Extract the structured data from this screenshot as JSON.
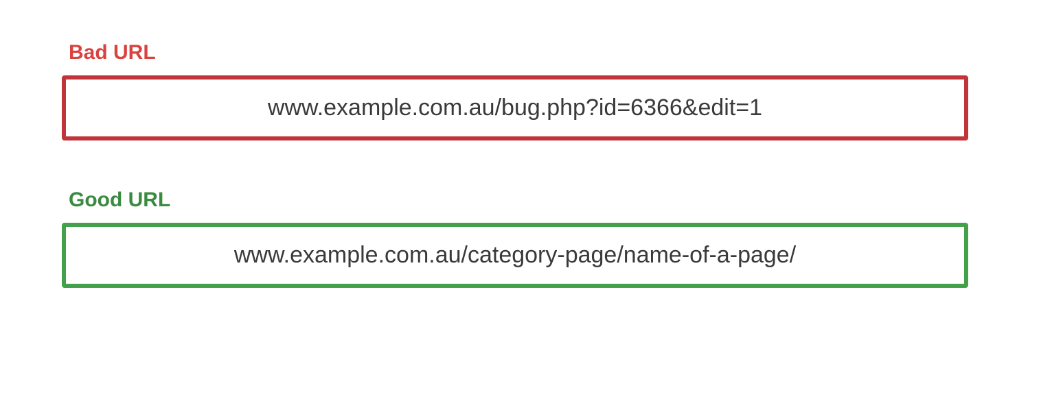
{
  "bad": {
    "label": "Bad URL",
    "url": "www.example.com.au/bug.php?id=6366&edit=1"
  },
  "good": {
    "label": "Good URL",
    "url": "www.example.com.au/category-page/name-of-a-page/"
  },
  "colors": {
    "bad_label": "#d9433f",
    "bad_border": "#c1343a",
    "good_label": "#3a8a3f",
    "good_border": "#44a04b"
  }
}
